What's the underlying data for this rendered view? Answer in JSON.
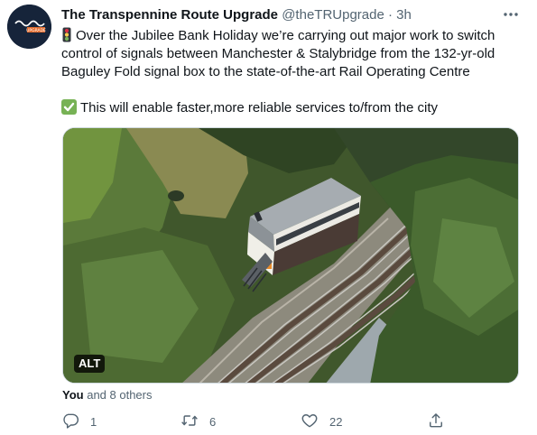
{
  "author": {
    "name": "The Transpennine Route Upgrade",
    "handle": "@theTRUpgrade",
    "separator": "·",
    "time": "3h",
    "avatar_label": "UPGRADE"
  },
  "tweet": {
    "lines": [
      "Over the Jubilee Bank Holiday we’re carrying out major work to switch",
      "control of signals between Manchester & Stalybridge from the 132-yr-old",
      "Baguley Fold signal box to the state-of-the-art Rail Operating Centre"
    ],
    "line2": "This will enable faster,more reliable services to/from the city"
  },
  "media": {
    "alt_label": "ALT"
  },
  "liked_by": {
    "you": "You",
    "rest": "and 8 others"
  },
  "actions": {
    "reply_count": "1",
    "retweet_count": "6",
    "like_count": "22"
  },
  "icons": {
    "traffic_light": "traffic-light-icon",
    "check": "check-mark-icon",
    "reply": "reply-icon",
    "retweet": "retweet-icon",
    "like": "heart-icon",
    "share": "share-icon",
    "more": "more-icon"
  },
  "colors": {
    "secondary_text": "#536471",
    "check_green": "#77b255",
    "avatar_bg": "#16243a"
  }
}
